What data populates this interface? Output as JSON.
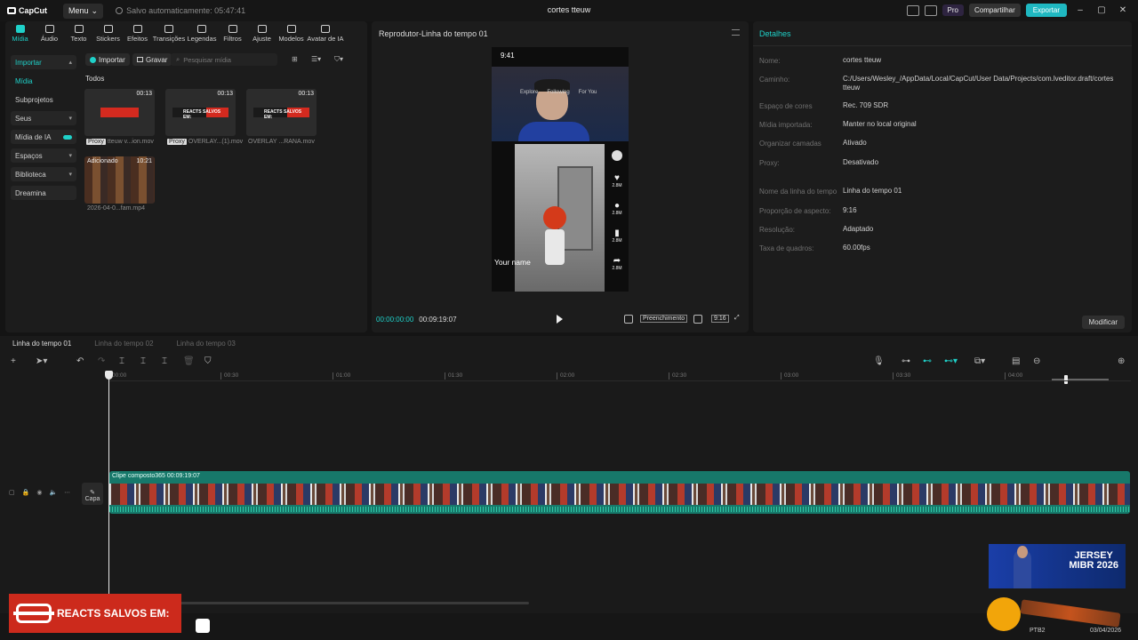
{
  "app": {
    "name": "CapCut",
    "menu_label": "Menu",
    "saved_text": "Salvo automaticamente: 05:47:41",
    "project_title": "cortes tteuw"
  },
  "topbar": {
    "pro_label": "Pro",
    "share_label": "Compartilhar",
    "export_label": "Exportar"
  },
  "tools": [
    {
      "label": "Mídia",
      "icon": "media-icon",
      "active": true
    },
    {
      "label": "Áudio",
      "icon": "audio-icon"
    },
    {
      "label": "Texto",
      "icon": "text-icon"
    },
    {
      "label": "Stickers",
      "icon": "sticker-icon"
    },
    {
      "label": "Efeitos",
      "icon": "effects-icon"
    },
    {
      "label": "Transições",
      "icon": "transitions-icon"
    },
    {
      "label": "Legendas",
      "icon": "captions-icon"
    },
    {
      "label": "Filtros",
      "icon": "filters-icon"
    },
    {
      "label": "Ajuste",
      "icon": "adjust-icon"
    },
    {
      "label": "Modelos",
      "icon": "templates-icon"
    },
    {
      "label": "Avatar de IA",
      "icon": "ai-avatar-icon"
    }
  ],
  "sidebar": {
    "items": [
      {
        "label": "Importar"
      },
      {
        "label": "Mídia"
      },
      {
        "label": "Subprojetos"
      },
      {
        "label": "Seus"
      },
      {
        "label": "Mídia de IA"
      },
      {
        "label": "Espaços"
      },
      {
        "label": "Biblioteca"
      },
      {
        "label": "Dreamina"
      }
    ]
  },
  "media": {
    "import_label": "Importar",
    "record_label": "Gravar",
    "search_placeholder": "Pesquisar mídia",
    "section_label": "Todos",
    "items": [
      {
        "name": "tteuw v...ion.mov",
        "duration": "00:13",
        "proxy": "Proxy"
      },
      {
        "name": "OVERLAY...(1).mov",
        "duration": "00:13",
        "proxy": "Proxy",
        "banner": "REACTS SALVOS EM:"
      },
      {
        "name": "OVERLAY ...RANA.mov",
        "duration": "00:13",
        "banner": "REACTS SALVOS EM:"
      },
      {
        "name": "2026-04-0...fam.mp4",
        "duration": "10:21",
        "badge": "Adicionado"
      }
    ]
  },
  "player": {
    "title": "Reprodutor-Linha do tempo 01",
    "current_time": "00:00:00:00",
    "total_time": "00:09:19:07",
    "fill_label": "Preenchimento",
    "ratio_label": "9:16",
    "phone": {
      "status_time": "9:41",
      "nav": [
        "Explore",
        "Following",
        "For You"
      ],
      "counts": [
        "2.8M",
        "2.8M",
        "2.8M",
        "2.8M"
      ],
      "your_name": "Your name"
    }
  },
  "details": {
    "title": "Detalhes",
    "rows": [
      {
        "label": "Nome:",
        "value": "cortes tteuw"
      },
      {
        "label": "Caminho:",
        "value": "C:/Users/Wesley_/AppData/Local/CapCut/User Data/Projects/com.lveditor.draft/cortes tteuw"
      },
      {
        "label": "Espaço de cores",
        "value": "Rec. 709 SDR"
      },
      {
        "label": "Mídia importada:",
        "value": "Manter no local original"
      },
      {
        "label": "Organizar camadas",
        "value": "Ativado"
      },
      {
        "label": "Proxy:",
        "value": "Desativado"
      },
      {
        "label": "Nome da linha do tempo",
        "value": "Linha do tempo 01"
      },
      {
        "label": "Proporção de aspecto:",
        "value": "9:16"
      },
      {
        "label": "Resolução:",
        "value": "Adaptado"
      },
      {
        "label": "Taxa de quadros:",
        "value": "60.00fps"
      }
    ],
    "modify_label": "Modificar"
  },
  "timeline": {
    "tabs": [
      "Linha do tempo 01",
      "Linha do tempo 02",
      "Linha do tempo 03"
    ],
    "ruler": [
      "00:00",
      "00:30",
      "01:00",
      "01:30",
      "02:00",
      "02:30",
      "03:00",
      "03:30",
      "04:00"
    ],
    "clip_label": "Clipe composto365",
    "clip_duration": "00:09:19:07",
    "cover_label": "Capa"
  },
  "overlay": {
    "banner_text": "REACTS SALVOS EM:"
  },
  "ad": {
    "title_line1": "JERSEY",
    "title_line2": "MIBR 2026"
  },
  "taskbar": {
    "lang": "PTB2",
    "date": "03/04/2026"
  }
}
